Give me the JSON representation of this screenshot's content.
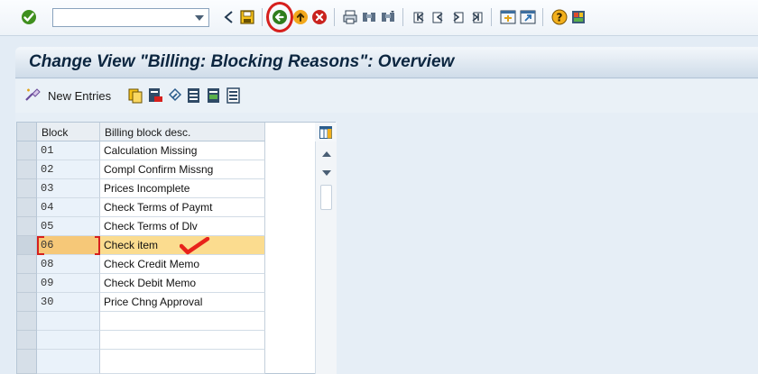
{
  "toolbar": {
    "command_field_value": "",
    "icons": [
      "enter-check-icon",
      "command-dropdown-icon",
      "back-triangle-icon",
      "save-icon",
      "back-icon",
      "exit-icon",
      "cancel-icon",
      "print-icon",
      "find-icon",
      "find-next-icon",
      "first-page-icon",
      "previous-page-icon",
      "next-page-icon",
      "last-page-icon",
      "create-session-icon",
      "shortcut-icon",
      "help-icon",
      "layout-icon"
    ],
    "highlighted_icon": "back-icon",
    "highlight_color": "#d6201d"
  },
  "title": {
    "text": "Change View \"Billing: Blocking Reasons\": Overview"
  },
  "app_toolbar": {
    "new_entries_label": "New Entries",
    "icons": [
      "new-entries-icon",
      "copy-as-icon",
      "delete-icon",
      "undo-change-icon",
      "select-all-icon",
      "select-block-icon",
      "deselect-all-icon"
    ]
  },
  "table": {
    "columns": [
      "Block",
      "Billing block desc."
    ],
    "rows": [
      {
        "block": "01",
        "desc": "Calculation Missing"
      },
      {
        "block": "02",
        "desc": "Compl Confirm Missng"
      },
      {
        "block": "03",
        "desc": "Prices Incomplete"
      },
      {
        "block": "04",
        "desc": "Check Terms of Paymt"
      },
      {
        "block": "05",
        "desc": "Check Terms of Dlv"
      },
      {
        "block": "06",
        "desc": "Check item"
      },
      {
        "block": "08",
        "desc": "Check Credit Memo"
      },
      {
        "block": "09",
        "desc": "Check Debit Memo"
      },
      {
        "block": "30",
        "desc": "Price Chng Approval"
      },
      {
        "block": "",
        "desc": ""
      },
      {
        "block": "",
        "desc": ""
      },
      {
        "block": "",
        "desc": ""
      }
    ],
    "selected_row_index": 5,
    "selected_color": "#fbdc8f",
    "annotation_color": "#e8231b"
  }
}
